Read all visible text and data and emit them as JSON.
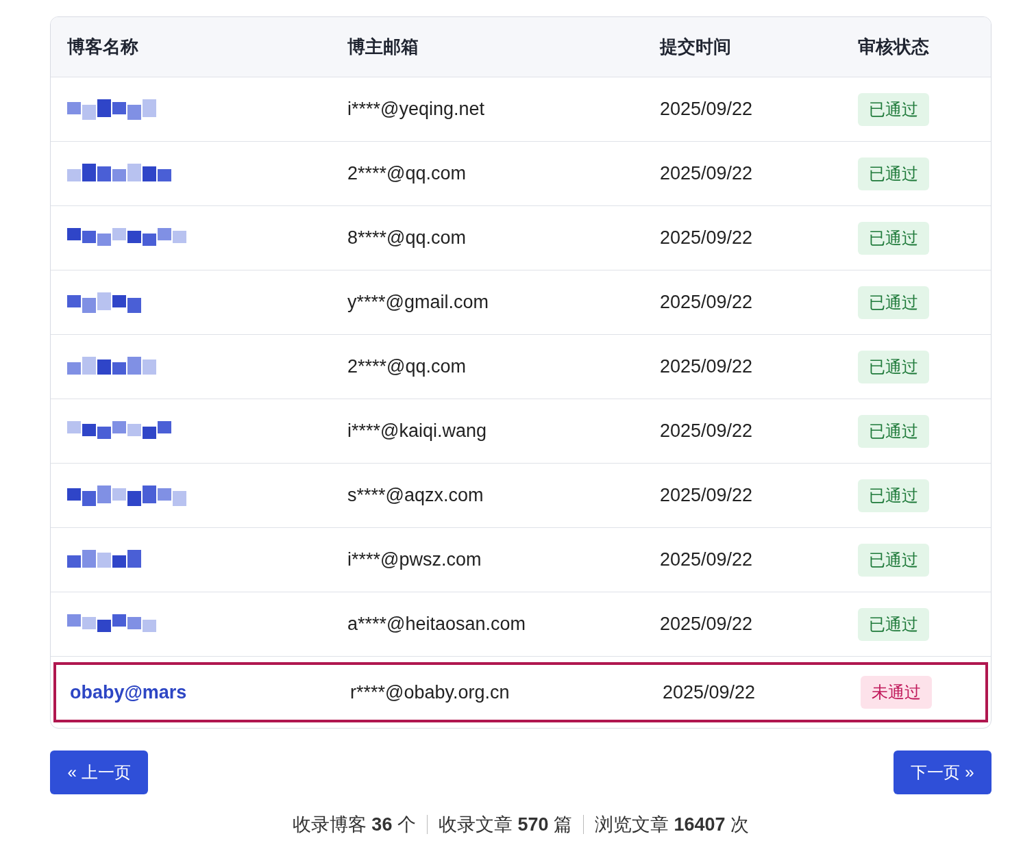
{
  "table": {
    "columns": [
      "博客名称",
      "博主邮箱",
      "提交时间",
      "审核状态"
    ],
    "rows": [
      {
        "name": {
          "kind": "redacted"
        },
        "email": "i****@yeqing.net",
        "date": "2025/09/22",
        "status": {
          "label": "已通过",
          "kind": "approved"
        },
        "highlighted": false
      },
      {
        "name": {
          "kind": "redacted"
        },
        "email": "2****@qq.com",
        "date": "2025/09/22",
        "status": {
          "label": "已通过",
          "kind": "approved"
        },
        "highlighted": false
      },
      {
        "name": {
          "kind": "redacted"
        },
        "email": "8****@qq.com",
        "date": "2025/09/22",
        "status": {
          "label": "已通过",
          "kind": "approved"
        },
        "highlighted": false
      },
      {
        "name": {
          "kind": "redacted"
        },
        "email": "y****@gmail.com",
        "date": "2025/09/22",
        "status": {
          "label": "已通过",
          "kind": "approved"
        },
        "highlighted": false
      },
      {
        "name": {
          "kind": "redacted"
        },
        "email": "2****@qq.com",
        "date": "2025/09/22",
        "status": {
          "label": "已通过",
          "kind": "approved"
        },
        "highlighted": false
      },
      {
        "name": {
          "kind": "redacted"
        },
        "email": "i****@kaiqi.wang",
        "date": "2025/09/22",
        "status": {
          "label": "已通过",
          "kind": "approved"
        },
        "highlighted": false
      },
      {
        "name": {
          "kind": "redacted"
        },
        "email": "s****@aqzx.com",
        "date": "2025/09/22",
        "status": {
          "label": "已通过",
          "kind": "approved"
        },
        "highlighted": false
      },
      {
        "name": {
          "kind": "redacted"
        },
        "email": "i****@pwsz.com",
        "date": "2025/09/22",
        "status": {
          "label": "已通过",
          "kind": "approved"
        },
        "highlighted": false
      },
      {
        "name": {
          "kind": "redacted"
        },
        "email": "a****@heitaosan.com",
        "date": "2025/09/22",
        "status": {
          "label": "已通过",
          "kind": "approved"
        },
        "highlighted": false
      },
      {
        "name": {
          "kind": "text",
          "text": "obaby@mars"
        },
        "email": "r****@obaby.org.cn",
        "date": "2025/09/22",
        "status": {
          "label": "未通过",
          "kind": "rejected"
        },
        "highlighted": true
      }
    ]
  },
  "pagination": {
    "prev": "« 上一页",
    "next": "下一页 »"
  },
  "stats": [
    "收录博客 **36** 个",
    "收录文章 **570** 篇",
    "浏览文章 **16407** 次"
  ]
}
